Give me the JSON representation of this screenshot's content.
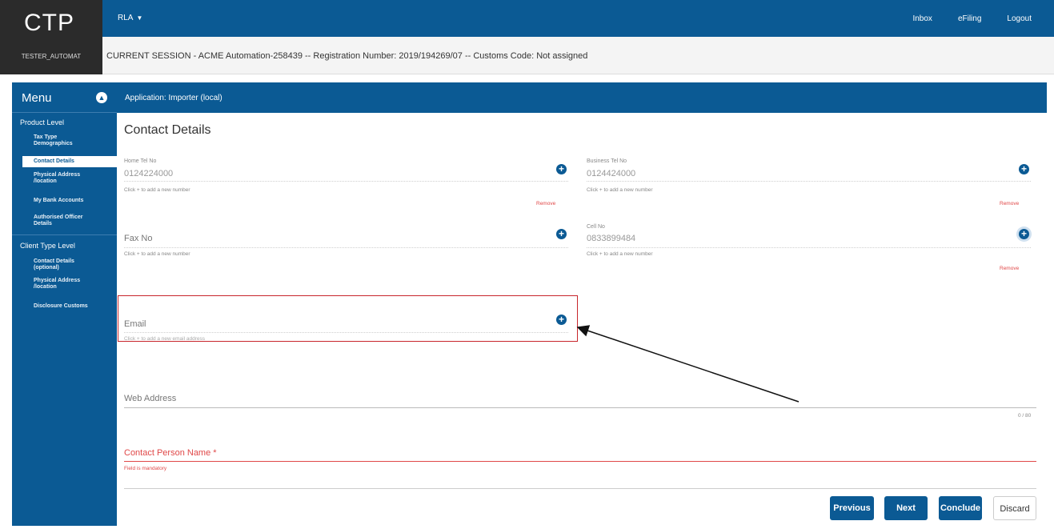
{
  "brand": {
    "logo": "CTP",
    "user": "TESTER_AUTOMAT"
  },
  "topbar": {
    "rla": "RLA",
    "nav": {
      "inbox": "Inbox",
      "efiling": "eFiling",
      "logout": "Logout"
    }
  },
  "session": {
    "text": "CURRENT SESSION - ACME Automation-258439 -- Registration Number: 2019/194269/07 -- Customs Code: Not assigned"
  },
  "sidebar": {
    "menu_title": "Menu",
    "product_level": "Product Level",
    "product_items": [
      "Tax Type Demographics",
      "Contact Details",
      "Physical Address /location",
      "My Bank Accounts",
      "Authorised Officer Details"
    ],
    "client_level": "Client Type Level",
    "client_items": [
      "Contact Details (optional)",
      "Physical Address /location",
      "Disclosure Customs"
    ]
  },
  "app_bar": {
    "title": "Application: Importer (local)"
  },
  "page": {
    "title": "Contact Details"
  },
  "fields": {
    "home": {
      "label": "Home Tel No",
      "value": "0124224000",
      "helper": "Click + to add a new number",
      "remove": "Remove"
    },
    "business": {
      "label": "Business Tel No",
      "value": "0124424000",
      "helper": "Click + to add a new number",
      "remove": "Remove"
    },
    "fax": {
      "label": "Fax No",
      "helper": "Click + to add a new number"
    },
    "cell": {
      "label": "Cell No",
      "value": "0833899484",
      "helper": "Click + to add a new number",
      "remove": "Remove"
    },
    "email": {
      "label": "Email",
      "helper": "Click + to add a new email address"
    },
    "web": {
      "label": "Web Address",
      "counter": "0 / 80"
    },
    "contact": {
      "label": "Contact Person Name *",
      "error": "Field is mandatory"
    }
  },
  "buttons": {
    "previous": "Previous",
    "next": "Next",
    "conclude": "Conclude",
    "discard": "Discard"
  },
  "colors": {
    "brand_blue": "#0b5a94",
    "error_red": "#e04848",
    "highlight_red": "#c8262c"
  }
}
